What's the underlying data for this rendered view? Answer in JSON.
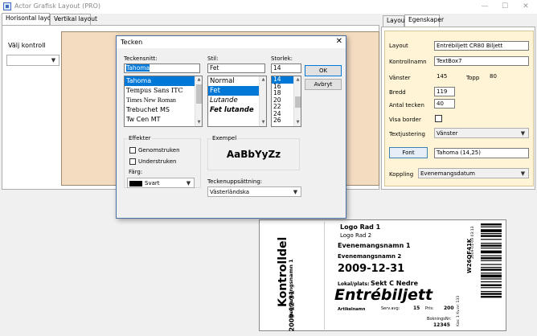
{
  "window": {
    "title": "Actor Grafisk Layout  (PRO)",
    "minimize": "—",
    "maximize": "☐",
    "close": "✕"
  },
  "main_tabs": [
    {
      "label": "Horisontal layout",
      "active": true
    },
    {
      "label": "Vertikal layout",
      "active": false
    }
  ],
  "left_panel": {
    "choose_label": "Välj kontroll",
    "choose_value": ""
  },
  "side_tabs": [
    {
      "label": "Layout",
      "active": false
    },
    {
      "label": "Egenskaper",
      "active": true
    }
  ],
  "properties": {
    "layout_label": "Layout",
    "layout_value": "Entrébiljett CR80 Biljett",
    "name_label": "Kontrollnamn",
    "name_value": "TextBox7",
    "left_label": "Vänster",
    "left_value": "145",
    "top_label": "Topp",
    "top_value": "80",
    "width_label": "Bredd",
    "width_value": "119",
    "chars_label": "Antal tecken",
    "chars_value": "40",
    "border_label": "Visa border",
    "border_checked": false,
    "justify_label": "Textjustering",
    "justify_value": "Vänster",
    "font_button": "Font",
    "font_value": "Tahoma (14,25)",
    "link_label": "Koppling",
    "link_value": "Evenemangsdatum"
  },
  "font_dialog": {
    "title": "Tecken",
    "close": "✕",
    "font_label": "Teckensnitt:",
    "font_value": "Tahoma",
    "fonts": [
      "Tahoma",
      "Tempus Sans ITC",
      "Times New Roman",
      "Trebuchet MS",
      "Tw Cen MT"
    ],
    "style_label": "Stil:",
    "style_value": "Fet",
    "styles": [
      "Normal",
      "Fet",
      "Lutande",
      "Fet lutande"
    ],
    "size_label": "Storlek:",
    "size_value": "14",
    "sizes": [
      "14",
      "16",
      "18",
      "20",
      "22",
      "24",
      "26"
    ],
    "ok_button": "OK",
    "cancel_button": "Avbryt",
    "effects_label": "Effekter",
    "strike_label": "Genomstruken",
    "underline_label": "Understruken",
    "color_label": "Färg:",
    "color_value": "Svart",
    "sample_label": "Exempel",
    "sample_text": "AaBbYyZz",
    "charset_label": "Teckenuppsättning:",
    "charset_value": "Västerländska"
  },
  "ticket": {
    "stub_title": "Kontrolldel",
    "stub_date": "2009-12-31",
    "stub_event": "Evenemangsnamn 1",
    "logo1": "Logo Rad 1",
    "logo2": "Logo Rad 2",
    "event1": "Evenemangsnamn 1",
    "event2": "Evenemangsnamn 2",
    "date": "2009-12-31",
    "venue_label": "Lokal/plats:",
    "venue_value": "Sekt C Nedre",
    "heading": "Entrébiljett",
    "article_label": "Artikelnamn",
    "service_label": "Serv.avg:",
    "service_value": "15",
    "price_label": "Pris:",
    "price_value": "200",
    "booking_label": "BokningsNr:",
    "booking_value": "12345",
    "right_code": "W26QF41K",
    "right_date": "2009-01-09 03:13",
    "right_small": "Kas: 1  Kv.nr: 133",
    "right_small2": "Kv.nr: 133"
  }
}
